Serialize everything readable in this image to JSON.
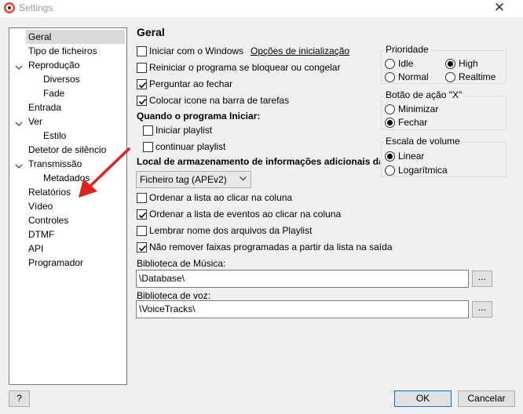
{
  "window": {
    "title": "Settings",
    "close_glyph": "✕"
  },
  "tree": {
    "items": [
      {
        "label": "Geral",
        "selected": true
      },
      {
        "label": "Tipo de ficheiros"
      },
      {
        "label": "Reprodução",
        "expanded": true
      },
      {
        "label": "Diversos"
      },
      {
        "label": "Fade"
      },
      {
        "label": "Entrada"
      },
      {
        "label": "Ver",
        "expanded": true
      },
      {
        "label": "Estilo"
      },
      {
        "label": "Detetor de silêncio"
      },
      {
        "label": "Transmissão",
        "expanded": true
      },
      {
        "label": "Metadados"
      },
      {
        "label": "Relatórios"
      },
      {
        "label": "Vídeo"
      },
      {
        "label": "Controles"
      },
      {
        "label": "DTMF"
      },
      {
        "label": "API"
      },
      {
        "label": "Programador"
      }
    ]
  },
  "general": {
    "heading": "Geral",
    "start_with_windows": {
      "label": "Iniciar com o Windows",
      "checked": false
    },
    "startup_options_link": "Opções de inicialização",
    "restart_on_hang": {
      "label": "Reiniciar o programa se bloquear ou congelar",
      "checked": false
    },
    "ask_on_close": {
      "label": "Perguntar ao fechar",
      "checked": true
    },
    "tray_icon": {
      "label": "Colocar icone na barra de tarefas",
      "checked": true
    },
    "on_start_label": "Quando o programa Iniciar:",
    "start_playlist": {
      "label": "Iniciar playlist",
      "checked": false
    },
    "continue_playlist": {
      "label": "continuar playlist",
      "checked": false
    },
    "storage_label": "Local de armazenamento de informações adicionais da f",
    "storage_select": "Ficheiro tag (APEv2)",
    "sort_list": {
      "label": "Ordenar a lista ao clicar na coluna",
      "checked": false
    },
    "sort_events": {
      "label": "Ordenar a lista de eventos ao clicar na coluna",
      "checked": true
    },
    "remember_names": {
      "label": "Lembrar nome dos arquivos da Playlist",
      "checked": false
    },
    "keep_scheduled": {
      "label": "Não remover faixas programadas a partir da lista na saída",
      "checked": true
    },
    "music_library_label": "Biblioteca de Música:",
    "music_library_value": "\\Database\\",
    "voice_library_label": "Biblioteca de voz:",
    "voice_library_value": "\\VoiceTracks\\",
    "browse_label": "..."
  },
  "priority": {
    "title": "Prioridade",
    "options": [
      "Idle",
      "High",
      "Normal",
      "Realtime"
    ],
    "selected": "High"
  },
  "x_button": {
    "title": "Botão de ação \"X\"",
    "options": [
      "Minimizar",
      "Fechar"
    ],
    "selected": "Fechar"
  },
  "volume_scale": {
    "title": "Escala de volume",
    "options": [
      "Linear",
      "Logarítmica"
    ],
    "selected": "Linear"
  },
  "buttons": {
    "help": "?",
    "ok": "OK",
    "cancel": "Cancelar"
  }
}
